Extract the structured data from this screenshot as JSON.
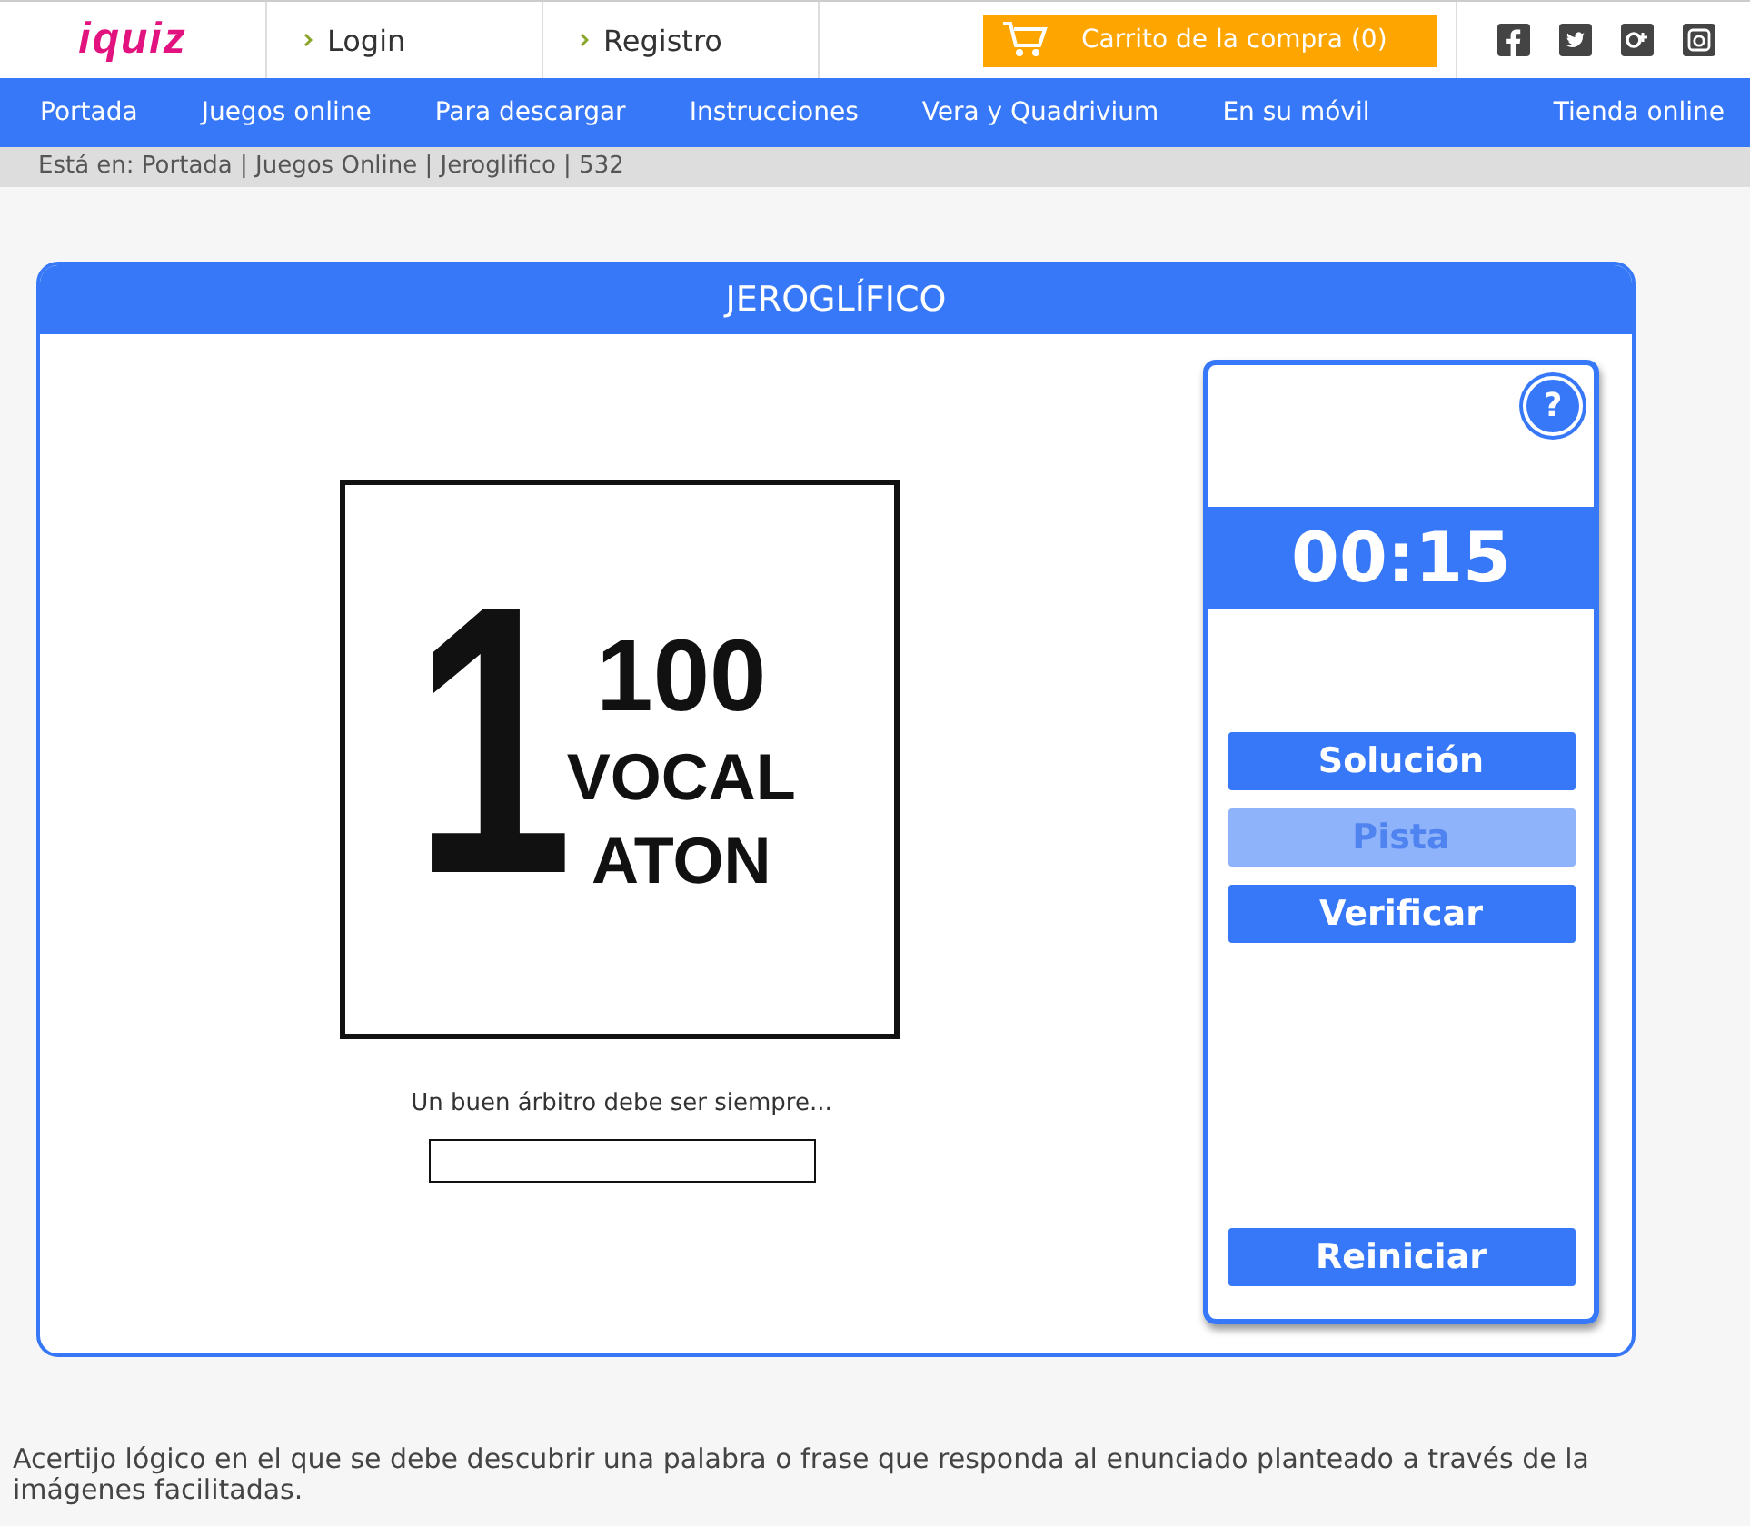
{
  "header": {
    "logo": "iquiz",
    "links": [
      "Login",
      "Registro"
    ],
    "cart": "Carrito de la compra (0)"
  },
  "nav": {
    "items": [
      "Portada",
      "Juegos online",
      "Para descargar",
      "Instrucciones",
      "Vera y Quadrivium",
      "En su móvil"
    ],
    "right_item": "Tienda online"
  },
  "breadcrumb": "Está en: Portada | Juegos Online | Jeroglifico | 532",
  "game": {
    "title": "JEROGLÍFICO",
    "puzzle": {
      "big": "1",
      "lines": [
        "100",
        "VOCAL",
        "ATON"
      ]
    },
    "clue": "Un buen árbitro debe ser siempre...",
    "panel": {
      "help": "?",
      "timer": "00:15",
      "buttons": [
        {
          "label": "Solución",
          "disabled": false
        },
        {
          "label": "Pista",
          "disabled": true
        },
        {
          "label": "Verificar",
          "disabled": false
        }
      ],
      "reset": "Reiniciar"
    }
  },
  "description": "Acertijo lógico en el que se debe descubrir una palabra o frase que responda al enunciado planteado a través de la imágenes facilitadas."
}
